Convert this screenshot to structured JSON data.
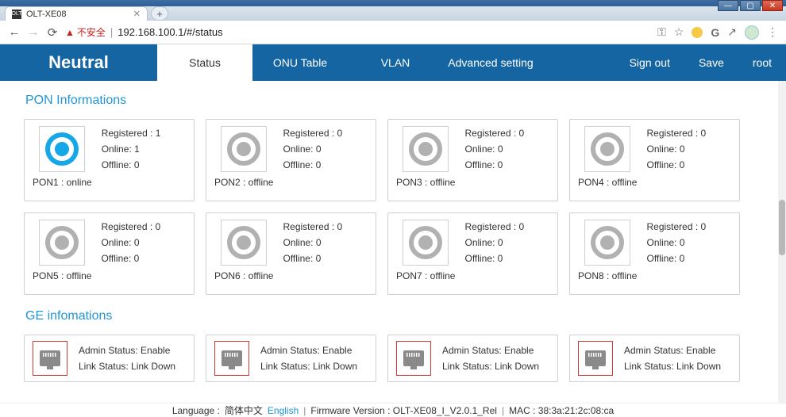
{
  "window": {
    "min_icon": "—",
    "max_icon": "▢",
    "close_icon": "✕"
  },
  "browser": {
    "tab_title": "OLT-XE08",
    "tab_favicon_text": "OLT",
    "tab_close": "✕",
    "newtab": "+",
    "back": "←",
    "forward": "→",
    "reload": "⟳",
    "insecure_label": "不安全",
    "url": "192.168.100.1/#/status",
    "icons": {
      "key": "⚿",
      "star": "☆",
      "translate": "G",
      "graph": "↗",
      "more": "⋮"
    }
  },
  "nav": {
    "brand": "Neutral",
    "tabs": [
      "Status",
      "ONU Table",
      "VLAN",
      "Advanced setting"
    ],
    "active_index": 0,
    "links": [
      "Sign out",
      "Save",
      "root"
    ]
  },
  "sections": {
    "pon_title": "PON Informations",
    "ge_title": "GE infomations"
  },
  "pon": [
    {
      "name": "PON1",
      "status": "online",
      "registered": 1,
      "online": 1,
      "offline": 0
    },
    {
      "name": "PON2",
      "status": "offline",
      "registered": 0,
      "online": 0,
      "offline": 0
    },
    {
      "name": "PON3",
      "status": "offline",
      "registered": 0,
      "online": 0,
      "offline": 0
    },
    {
      "name": "PON4",
      "status": "offline",
      "registered": 0,
      "online": 0,
      "offline": 0
    },
    {
      "name": "PON5",
      "status": "offline",
      "registered": 0,
      "online": 0,
      "offline": 0
    },
    {
      "name": "PON6",
      "status": "offline",
      "registered": 0,
      "online": 0,
      "offline": 0
    },
    {
      "name": "PON7",
      "status": "offline",
      "registered": 0,
      "online": 0,
      "offline": 0
    },
    {
      "name": "PON8",
      "status": "offline",
      "registered": 0,
      "online": 0,
      "offline": 0
    }
  ],
  "pon_labels": {
    "registered": "Registered",
    "online": "Online",
    "offline": "Offline"
  },
  "ge": [
    {
      "admin": "Enable",
      "link": "Link Down"
    },
    {
      "admin": "Enable",
      "link": "Link Down"
    },
    {
      "admin": "Enable",
      "link": "Link Down"
    },
    {
      "admin": "Enable",
      "link": "Link Down"
    }
  ],
  "ge_labels": {
    "admin": "Admin Status",
    "link": "Link Status"
  },
  "footer": {
    "lang_label": "Language",
    "lang_zh": "简体中文",
    "lang_en": "English",
    "fw_label": "Firmware Version",
    "fw_value": "OLT-XE08_I_V2.0.1_Rel",
    "mac_label": "MAC",
    "mac_value": "38:3a:21:2c:08:ca",
    "sep": "|"
  }
}
